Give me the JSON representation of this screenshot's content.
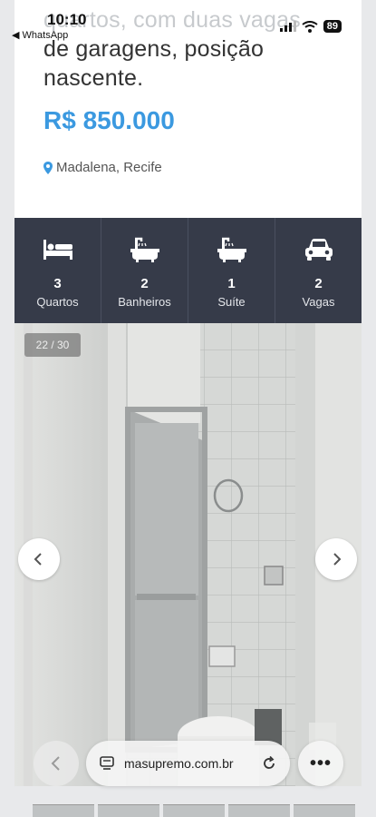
{
  "status_bar": {
    "time": "10:10",
    "back_app": "◀ WhatsApp",
    "battery": "89"
  },
  "listing": {
    "title_line1": "quartos, com duas vagas",
    "title_line2": "de garagens, posição",
    "title_line3": "nascente.",
    "price": "R$ 850.000",
    "location": "Madalena, Recife"
  },
  "features": [
    {
      "icon": "bed-icon",
      "value": "3",
      "label": "Quartos"
    },
    {
      "icon": "bathtub-icon",
      "value": "2",
      "label": "Banheiros"
    },
    {
      "icon": "bathtub-icon",
      "value": "1",
      "label": "Suíte"
    },
    {
      "icon": "car-icon",
      "value": "2",
      "label": "Vagas"
    }
  ],
  "gallery": {
    "counter": "22 / 30"
  },
  "browser": {
    "url": "masupremo.com.br",
    "more": "•••"
  },
  "colors": {
    "price": "#3b99e0",
    "features_bg": "#363b49",
    "pin": "#3b99e0"
  }
}
